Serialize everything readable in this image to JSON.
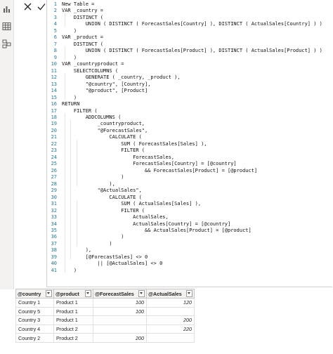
{
  "icons": {
    "sidebar": [
      "table-view-icon",
      "model-view-icon"
    ],
    "command": [
      "cancel-x-icon",
      "commit-check-icon"
    ]
  },
  "colors": {
    "line_number": "#237893",
    "grid_header_bg": "#f3f2f1"
  },
  "editor": {
    "lines": [
      {
        "n": "1",
        "t": "New Table ="
      },
      {
        "n": "2",
        "t": "VAR _country ="
      },
      {
        "n": "3",
        "t": "    DISTINCT ("
      },
      {
        "n": "4",
        "t": "        UNION ( DISTINCT ( ForecastSales[Country] ), DISTINCT ( ActualSales[Country] ) )"
      },
      {
        "n": "5",
        "t": "    )"
      },
      {
        "n": "6",
        "t": "VAR _product ="
      },
      {
        "n": "7",
        "t": "    DISTINCT ("
      },
      {
        "n": "8",
        "t": "        UNION ( DISTINCT ( ForecastSales[Product] ), DISTINCT ( ActualSales[Product] ) )"
      },
      {
        "n": "9",
        "t": "    )"
      },
      {
        "n": "10",
        "t": "VAR _countryproduct ="
      },
      {
        "n": "11",
        "t": "    SELECTCOLUMNS ("
      },
      {
        "n": "12",
        "t": "        GENERATE ( _country, _product ),"
      },
      {
        "n": "13",
        "t": "        \"@country\", [Country],"
      },
      {
        "n": "14",
        "t": "        \"@product\", [Product]"
      },
      {
        "n": "15",
        "t": "    )"
      },
      {
        "n": "16",
        "t": "RETURN"
      },
      {
        "n": "17",
        "t": "    FILTER ("
      },
      {
        "n": "18",
        "t": "        ADDCOLUMNS ("
      },
      {
        "n": "19",
        "t": "            _countryproduct,"
      },
      {
        "n": "20",
        "t": "            \"@ForecastSales\","
      },
      {
        "n": "21",
        "t": "                CALCULATE ("
      },
      {
        "n": "22",
        "t": "                    SUM ( ForecastSales[Sales] ),"
      },
      {
        "n": "23",
        "t": "                    FILTER ("
      },
      {
        "n": "24",
        "t": "                        ForecastSales,"
      },
      {
        "n": "25",
        "t": "                        ForecastSales[Country] = [@country]"
      },
      {
        "n": "26",
        "t": "                            && ForecastSales[Product] = [@product]"
      },
      {
        "n": "27",
        "t": "                    )"
      },
      {
        "n": "28",
        "t": "                ),"
      },
      {
        "n": "29",
        "t": "            \"@ActualSales\","
      },
      {
        "n": "30",
        "t": "                CALCULATE ("
      },
      {
        "n": "31",
        "t": "                    SUM ( ActualSales[Sales] ),"
      },
      {
        "n": "32",
        "t": "                    FILTER ("
      },
      {
        "n": "33",
        "t": "                        ActualSales,"
      },
      {
        "n": "34",
        "t": "                        ActualSales[Country] = [@country]"
      },
      {
        "n": "35",
        "t": "                            && ActualSales[Product] = [@product]"
      },
      {
        "n": "36",
        "t": "                    )"
      },
      {
        "n": "37",
        "t": "                )"
      },
      {
        "n": "38",
        "t": "        ),"
      },
      {
        "n": "39",
        "t": "        [@ForecastSales] <> 0"
      },
      {
        "n": "40",
        "t": "            || [@ActualSales] <> 0"
      },
      {
        "n": "41",
        "t": "    )"
      }
    ]
  },
  "grid": {
    "columns": [
      "@country",
      "@product",
      "@ForecastSales",
      "@ActualSales"
    ],
    "rows": [
      [
        "Country 1",
        "Product 1",
        "100",
        "120"
      ],
      [
        "Country 5",
        "Product 1",
        "100",
        ""
      ],
      [
        "Country 3",
        "Product 1",
        "",
        "200"
      ],
      [
        "Country 4",
        "Product 2",
        "",
        "220"
      ],
      [
        "Country 2",
        "Product 2",
        "200",
        ""
      ]
    ]
  }
}
